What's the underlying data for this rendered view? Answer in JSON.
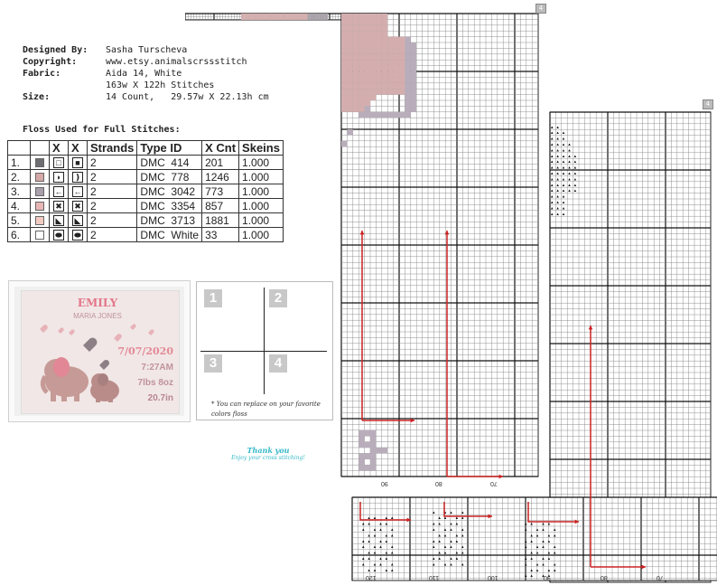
{
  "info": {
    "rows": [
      {
        "label": "Designed By:",
        "value": "Sasha Turscheva"
      },
      {
        "label": "Copyright:",
        "value": "www.etsy.animalscrssstitch"
      },
      {
        "label": "Fabric:",
        "value": "Aida 14, White"
      },
      {
        "label": "",
        "value": "163w X 122h Stitches"
      },
      {
        "label": "Size:",
        "value": "14 Count,   29.57w X 22.13h cm"
      }
    ],
    "floss_title": "Floss Used for Full Stitches:"
  },
  "floss_table": {
    "headers": [
      "",
      "",
      "X",
      "X",
      "Strands",
      "Type",
      "ID",
      "X Cnt",
      "Skeins"
    ],
    "rows": [
      {
        "num": "1.",
        "color": "#6e6e72",
        "sym_a": "□",
        "sym_b": "■",
        "strands": "2",
        "type": "DMC",
        "id": "414",
        "cnt": "201",
        "skeins": "1.000"
      },
      {
        "num": "2.",
        "color": "#d6a8a8",
        "sym_a": "◗",
        "sym_b": "❫",
        "strands": "2",
        "type": "DMC",
        "id": "778",
        "cnt": "1246",
        "skeins": "1.000"
      },
      {
        "num": "3.",
        "color": "#a8a0ac",
        "sym_a": "←",
        "sym_b": "←",
        "strands": "2",
        "type": "DMC",
        "id": "3042",
        "cnt": "773",
        "skeins": "1.000"
      },
      {
        "num": "4.",
        "color": "#e9b6b6",
        "sym_a": "✖",
        "sym_b": "✖",
        "strands": "2",
        "type": "DMC",
        "id": "3354",
        "cnt": "857",
        "skeins": "1.000"
      },
      {
        "num": "5.",
        "color": "#f3cbc3",
        "sym_a": "◣",
        "sym_b": "◣",
        "strands": "2",
        "type": "DMC",
        "id": "3713",
        "cnt": "1881",
        "skeins": "1.000"
      },
      {
        "num": "6.",
        "color": "#ffffff",
        "sym_a": "⬬",
        "sym_b": "⬬",
        "strands": "2",
        "type": "DMC",
        "id": "White",
        "cnt": "33",
        "skeins": "1.000"
      }
    ]
  },
  "preview": {
    "name": "EMILY",
    "middle": "MARIA JONES",
    "date": "7/07/2020",
    "time": "7:27AM",
    "weight": "7lbs 8oz",
    "length": "20.7in",
    "name_color": "#e3778a",
    "text_color": "#b8868f"
  },
  "pagemap": {
    "numbers": [
      "1",
      "2",
      "3",
      "4"
    ],
    "note": "* You can replace on your favorite colors floss"
  },
  "thanks": {
    "line1": "Thank you",
    "line2": "Enjoy your cross stitching!"
  },
  "grid_labels": {
    "right_panel_bottom": [
      "90",
      "80",
      "70"
    ],
    "bottom_panel_bottom": [
      "120",
      "110",
      "100",
      "90",
      "80",
      "70"
    ]
  },
  "page_icon": "4",
  "colors": {
    "arrow": "#cc2222",
    "pink_fill": "#d4aeae",
    "gray_fill": "#b9adbb"
  }
}
